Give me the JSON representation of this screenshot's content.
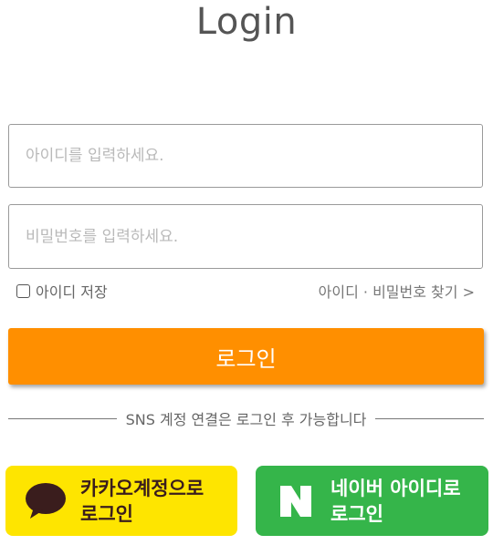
{
  "header": {
    "title": "Login"
  },
  "form": {
    "id_placeholder": "아이디를 입력하세요.",
    "pw_placeholder": "비밀번호를 입력하세요.",
    "remember_label": "아이디 저장",
    "find_link": "아이디 · 비밀번호 찾기 >",
    "login_button": "로그인"
  },
  "sns": {
    "notice": "SNS 계정 연결은 로그인 후 가능합니다",
    "kakao": {
      "line1": "카카오계정으로",
      "line2": "로그인",
      "icon": "chat-bubble-icon",
      "color": "#fee500"
    },
    "naver": {
      "line1": "네이버 아이디로",
      "line2": "로그인",
      "icon": "naver-n-icon",
      "color": "#35b54a"
    }
  },
  "colors": {
    "accent": "#ff8f00"
  }
}
